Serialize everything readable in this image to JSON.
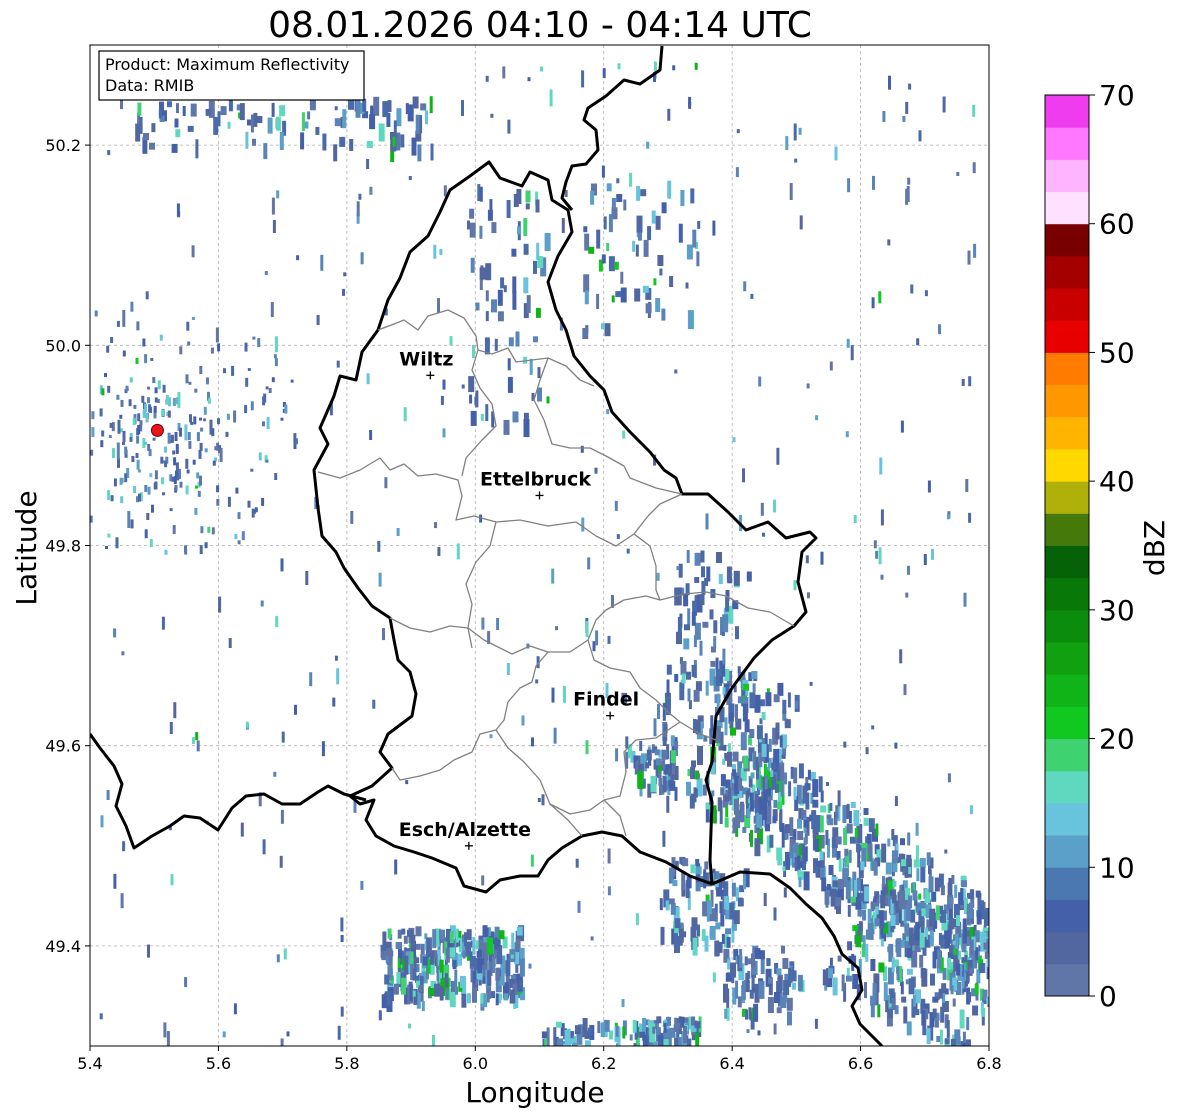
{
  "title": "08.01.2026 04:10 - 04:14 UTC",
  "info": {
    "product": "Product: Maximum Reflectivity",
    "source": "Data: RMIB"
  },
  "axes": {
    "xlabel": "Longitude",
    "ylabel": "Latitude",
    "xlim": [
      5.4,
      6.8
    ],
    "ylim": [
      49.3,
      50.3
    ],
    "xticks": [
      "5.4",
      "5.6",
      "5.8",
      "6.0",
      "6.2",
      "6.4",
      "6.6",
      "6.8"
    ],
    "yticks": [
      "49.4",
      "49.6",
      "49.8",
      "50.0",
      "50.2"
    ],
    "grid": true
  },
  "colorbar": {
    "label": "dBZ",
    "ticks": [
      "0",
      "10",
      "20",
      "30",
      "40",
      "50",
      "60",
      "70"
    ],
    "range": [
      0,
      70
    ],
    "colors": [
      "#6076a8",
      "#5266a0",
      "#4460a8",
      "#4b78b0",
      "#5aa0c8",
      "#68c4dc",
      "#60d8c0",
      "#3ed270",
      "#10c820",
      "#10b418",
      "#10a010",
      "#0c8c0c",
      "#087808",
      "#066206",
      "#457a0a",
      "#b0b00a",
      "#ffd800",
      "#ffb400",
      "#ff9800",
      "#ff7c00",
      "#e80000",
      "#c80000",
      "#a40000",
      "#780000",
      "#ffe0ff",
      "#ffb4ff",
      "#ff78ff",
      "#ee3cee"
    ]
  },
  "cities": [
    {
      "name": "Wiltz",
      "lon": 5.93,
      "lat": 49.97
    },
    {
      "name": "Ettelbruck",
      "lon": 6.1,
      "lat": 49.85
    },
    {
      "name": "Findel",
      "lon": 6.21,
      "lat": 49.63
    },
    {
      "name": "Esch/Alzette",
      "lon": 5.99,
      "lat": 49.5
    }
  ],
  "radar_site": {
    "lon": 5.505,
    "lat": 49.915,
    "color": "#e8141e"
  }
}
